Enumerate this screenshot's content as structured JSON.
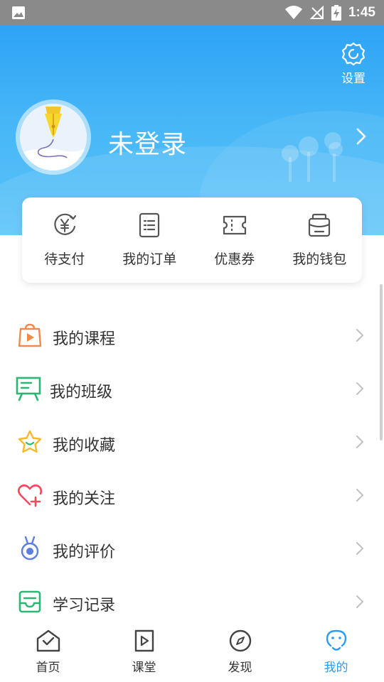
{
  "status_bar": {
    "time": "1:45",
    "icons": [
      "image-icon",
      "wifi-icon",
      "no-signal-icon",
      "battery-charging-icon"
    ]
  },
  "header": {
    "settings_label": "设置",
    "username": "未登录"
  },
  "quick_actions": [
    {
      "label": "待支付",
      "icon": "yen-refresh-icon"
    },
    {
      "label": "我的订单",
      "icon": "order-list-icon"
    },
    {
      "label": "优惠券",
      "icon": "coupon-icon"
    },
    {
      "label": "我的钱包",
      "icon": "wallet-icon"
    }
  ],
  "menu": [
    {
      "label": "我的课程",
      "icon": "course-bag-icon",
      "color": "#f08a4b"
    },
    {
      "label": "我的班级",
      "icon": "class-board-icon",
      "color": "#2bb673"
    },
    {
      "label": "我的收藏",
      "icon": "star-icon",
      "color": "#f6b92b"
    },
    {
      "label": "我的关注",
      "icon": "heart-plus-icon",
      "color": "#ef4b5c"
    },
    {
      "label": "我的评价",
      "icon": "medal-icon",
      "color": "#5a7fe0"
    },
    {
      "label": "学习记录",
      "icon": "record-inbox-icon",
      "color": "#2bb673"
    }
  ],
  "bottom_nav": [
    {
      "label": "首页",
      "icon": "home-icon",
      "active": false
    },
    {
      "label": "课堂",
      "icon": "classroom-play-icon",
      "active": false
    },
    {
      "label": "发现",
      "icon": "compass-icon",
      "active": false
    },
    {
      "label": "我的",
      "icon": "profile-face-icon",
      "active": true
    }
  ],
  "colors": {
    "header_top": "#2ea3f6",
    "header_bottom": "#5bc4f8",
    "accent": "#2b9cf2",
    "text": "#333333",
    "chevron": "#c0c0c0"
  }
}
